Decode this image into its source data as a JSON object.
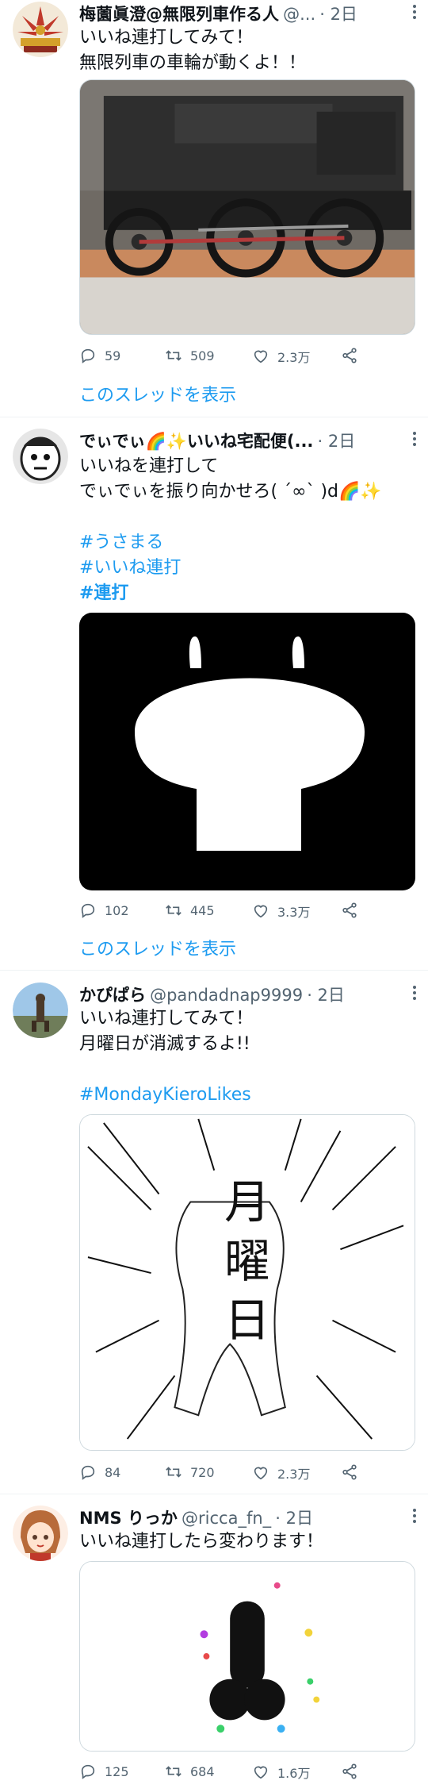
{
  "tweets": [
    {
      "name": "梅薗眞澄@無限列車作る人",
      "handle": "@...",
      "time": "· 2日",
      "lines": [
        "いいね連打してみて！",
        "無限列車の車輪が動くよ！！"
      ],
      "hashtags": [],
      "replies": "59",
      "retweets": "509",
      "likes": "2.3万",
      "thread": "このスレッドを表示"
    },
    {
      "name": "でぃでぃ🌈✨いいね宅配便(...",
      "handle": "",
      "time": "· 2日",
      "lines": [
        "いいねを連打して",
        "でぃでぃを振り向かせろ( ´∞` )d🌈✨"
      ],
      "hashtags": [
        "#うさまる",
        "#いいね連打",
        "#連打"
      ],
      "replies": "102",
      "retweets": "445",
      "likes": "3.3万",
      "thread": "このスレッドを表示"
    },
    {
      "name": "かぴぱら",
      "handle": "@pandadnap9999",
      "time": "· 2日",
      "lines": [
        "いいね連打してみて！",
        "月曜日が消滅するよ!!"
      ],
      "hashtags": [
        "#MondayKieroLikes"
      ],
      "replies": "84",
      "retweets": "720",
      "likes": "2.3万",
      "image_text": [
        "月",
        "曜",
        "日"
      ]
    },
    {
      "name": "NMS りっか",
      "handle": "@ricca_fn_",
      "time": "· 2日",
      "lines": [
        "いいね連打したら変わります！"
      ],
      "hashtags": [],
      "replies": "125",
      "retweets": "684",
      "likes": "1.6万"
    }
  ],
  "icons": {
    "reply": "reply-icon",
    "retweet": "retweet-icon",
    "like": "heart-icon",
    "share": "share-icon",
    "more": "more-icon"
  },
  "colors": {
    "link": "#1d9bf0",
    "secondary": "#536471",
    "divider": "#eff3f4"
  }
}
